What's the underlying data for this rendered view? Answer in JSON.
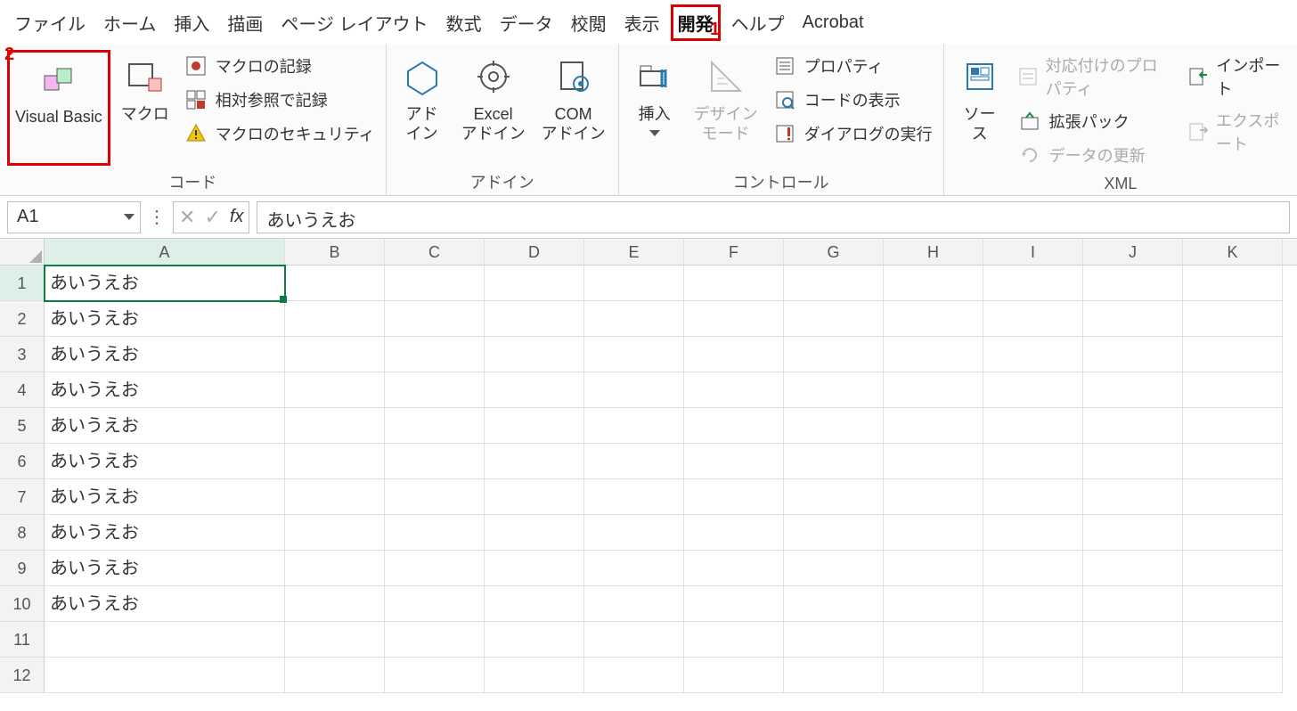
{
  "annotations": {
    "n1": "1",
    "n2": "2"
  },
  "menu": {
    "file": "ファイル",
    "home": "ホーム",
    "insert": "挿入",
    "draw": "描画",
    "pageLayout": "ページ レイアウト",
    "formulas": "数式",
    "data": "データ",
    "review": "校閲",
    "view": "表示",
    "developer": "開発",
    "help": "ヘルプ",
    "acrobat": "Acrobat"
  },
  "ribbon": {
    "code": {
      "vb": "Visual Basic",
      "macro": "マクロ",
      "record": "マクロの記録",
      "relative": "相対参照で記録",
      "security": "マクロのセキュリティ",
      "label": "コード"
    },
    "addins": {
      "addin": "アド\nイン",
      "excelAddin": "Excel\nアドイン",
      "comAddin": "COM\nアドイン",
      "label": "アドイン"
    },
    "controls": {
      "insert": "挿入",
      "design": "デザイン\nモード",
      "properties": "プロパティ",
      "viewCode": "コードの表示",
      "runDialog": "ダイアログの実行",
      "label": "コントロール"
    },
    "xml": {
      "source": "ソース",
      "mapProps": "対応付けのプロパティ",
      "expansion": "拡張パック",
      "refresh": "データの更新",
      "import": "インポート",
      "export": "エクスポート",
      "label": "XML"
    }
  },
  "formulaBar": {
    "nameBox": "A1",
    "formula": "あいうえお"
  },
  "grid": {
    "columns": [
      "A",
      "B",
      "C",
      "D",
      "E",
      "F",
      "G",
      "H",
      "I",
      "J",
      "K"
    ],
    "rows": [
      {
        "n": "1",
        "A": "あいうえお"
      },
      {
        "n": "2",
        "A": "あいうえお"
      },
      {
        "n": "3",
        "A": "あいうえお"
      },
      {
        "n": "4",
        "A": "あいうえお"
      },
      {
        "n": "5",
        "A": "あいうえお"
      },
      {
        "n": "6",
        "A": "あいうえお"
      },
      {
        "n": "7",
        "A": "あいうえお"
      },
      {
        "n": "8",
        "A": "あいうえお"
      },
      {
        "n": "9",
        "A": "あいうえお"
      },
      {
        "n": "10",
        "A": "あいうえお"
      },
      {
        "n": "11",
        "A": ""
      },
      {
        "n": "12",
        "A": ""
      }
    ]
  }
}
